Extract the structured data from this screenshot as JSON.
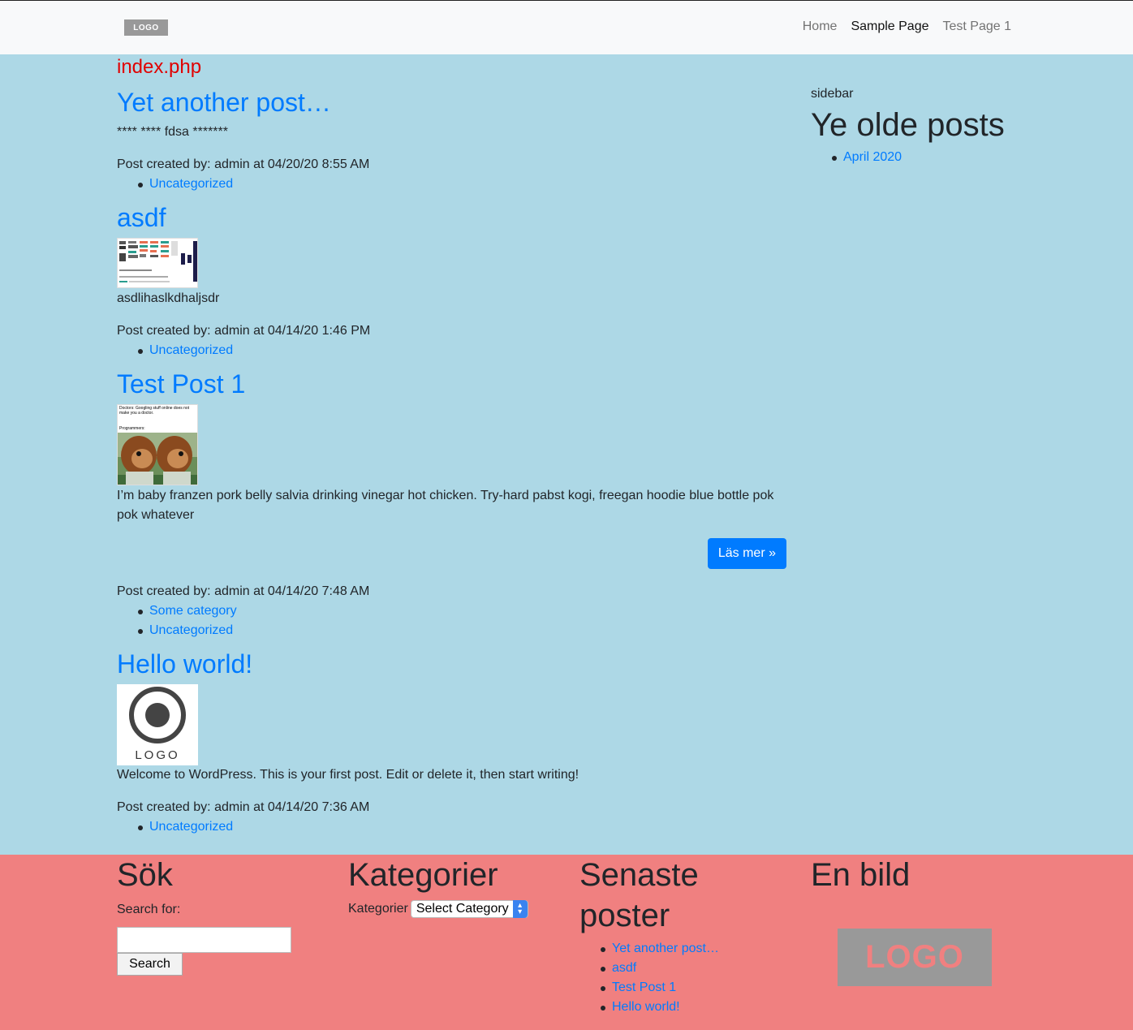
{
  "navbar": {
    "logo": "LOGO",
    "links": [
      "Home",
      "Sample Page",
      "Test Page 1"
    ]
  },
  "template_name": "index.php",
  "posts": [
    {
      "title": "Yet another post…",
      "excerpt": "**** **** fdsa *******",
      "meta": "Post created by: admin at 04/20/20 8:55 AM",
      "categories": [
        "Uncategorized"
      ]
    },
    {
      "title": "asdf",
      "excerpt": "asdlihaslkdhaljsdr",
      "meta": "Post created by: admin at 04/14/20 1:46 PM",
      "categories": [
        "Uncategorized"
      ]
    },
    {
      "title": "Test Post 1",
      "thumb_caption_1": "Doctors: Googling stuff online does not make you a doctor.",
      "thumb_caption_2": "Programmers:",
      "excerpt": "I’m baby franzen pork belly salvia drinking vinegar hot chicken. Try-hard pabst kogi, freegan hoodie blue bottle pok pok whatever",
      "read_more": "Läs mer »",
      "meta": "Post created by: admin at 04/14/20 7:48 AM",
      "categories": [
        "Some category",
        "Uncategorized"
      ]
    },
    {
      "title": "Hello world!",
      "thumb_label": "LOGO",
      "excerpt": "Welcome to WordPress. This is your first post. Edit or delete it, then start writing!",
      "meta": "Post created by: admin at 04/14/20 7:36 AM",
      "categories": [
        "Uncategorized"
      ]
    }
  ],
  "sidebar": {
    "label": "sidebar",
    "title": "Ye olde posts",
    "archives": [
      "April 2020"
    ]
  },
  "footer": {
    "search": {
      "heading": "Sök",
      "label": "Search for:",
      "value": "",
      "button": "Search"
    },
    "categories": {
      "heading": "Kategorier",
      "label": "Kategorier",
      "selected": "Select Category"
    },
    "recent": {
      "heading": "Senaste poster",
      "items": [
        "Yet another post…",
        "asdf",
        "Test Post 1",
        "Hello world!"
      ]
    },
    "image": {
      "heading": "En bild",
      "logo": "LOGO"
    }
  }
}
